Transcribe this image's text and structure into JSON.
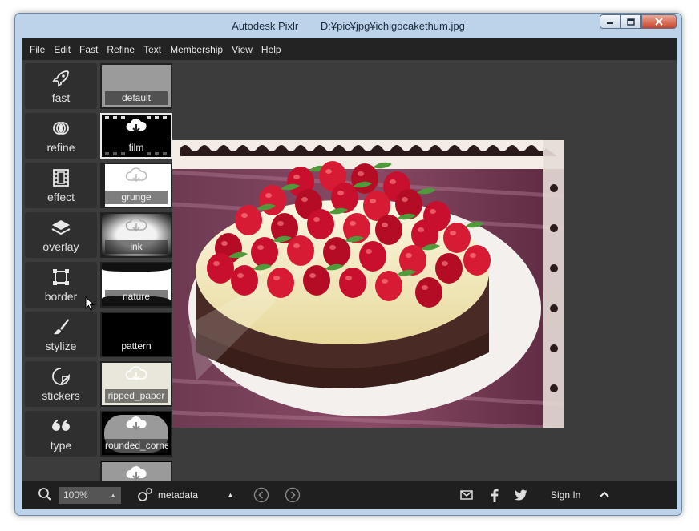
{
  "window": {
    "app_name": "Autodesk Pixlr",
    "file_path": "D:¥pic¥jpg¥ichigocakethum.jpg",
    "minimize_icon": "minimize-icon",
    "maximize_icon": "maximize-icon",
    "close_icon": "close-icon"
  },
  "menu": {
    "items": [
      "File",
      "Edit",
      "Fast",
      "Refine",
      "Text",
      "Membership",
      "View",
      "Help"
    ]
  },
  "tools": [
    {
      "label": "fast",
      "icon": "rocket-icon"
    },
    {
      "label": "refine",
      "icon": "refine-circles-icon"
    },
    {
      "label": "effect",
      "icon": "film-strip-icon"
    },
    {
      "label": "overlay",
      "icon": "layers-icon"
    },
    {
      "label": "border",
      "icon": "border-frame-icon"
    },
    {
      "label": "stylize",
      "icon": "brush-icon"
    },
    {
      "label": "stickers",
      "icon": "sticker-icon"
    },
    {
      "label": "type",
      "icon": "quote-icon"
    }
  ],
  "borders": {
    "items": [
      {
        "label": "default"
      },
      {
        "label": "film"
      },
      {
        "label": "grunge"
      },
      {
        "label": "ink"
      },
      {
        "label": "nature"
      },
      {
        "label": "pattern"
      },
      {
        "label": "ripped_paper"
      },
      {
        "label": "rounded_corne"
      },
      {
        "label": ""
      }
    ]
  },
  "bottombar": {
    "zoom_value": "100%",
    "metadata_label": "metadata",
    "signin_label": "Sign In"
  },
  "colors": {
    "app_bg": "#3c3c3c",
    "menubar_bg": "#232323",
    "panel_bg": "#2f2f2f",
    "window_frame": "#bcd3ea"
  }
}
